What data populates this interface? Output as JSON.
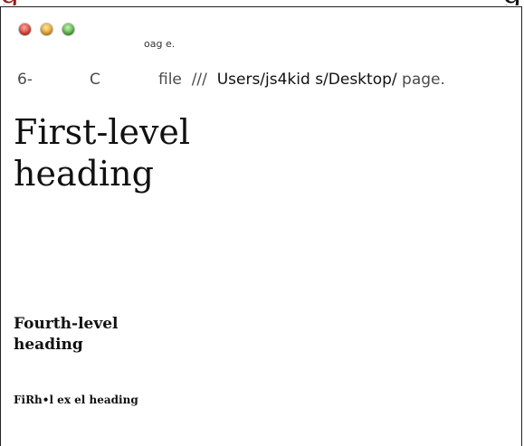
{
  "window": {
    "tab_title": "oag e."
  },
  "addressbar": {
    "back_label": "6-",
    "reload_label": "C",
    "url_scheme": "file  ///  ",
    "url_path": "Users/js4kid s/Desktop/",
    "url_file": " page."
  },
  "page": {
    "top_cut_left": "g",
    "top_cut_right": "g",
    "heading_1": "First-level heading",
    "heading_4": "Fourth-level heading",
    "heading_5": "FiRh•l ex el heading"
  },
  "colors": {
    "close": "#e0443a",
    "minimize": "#e8a72a",
    "zoom": "#5cb84a",
    "top_heading": "#9b1b1b"
  }
}
